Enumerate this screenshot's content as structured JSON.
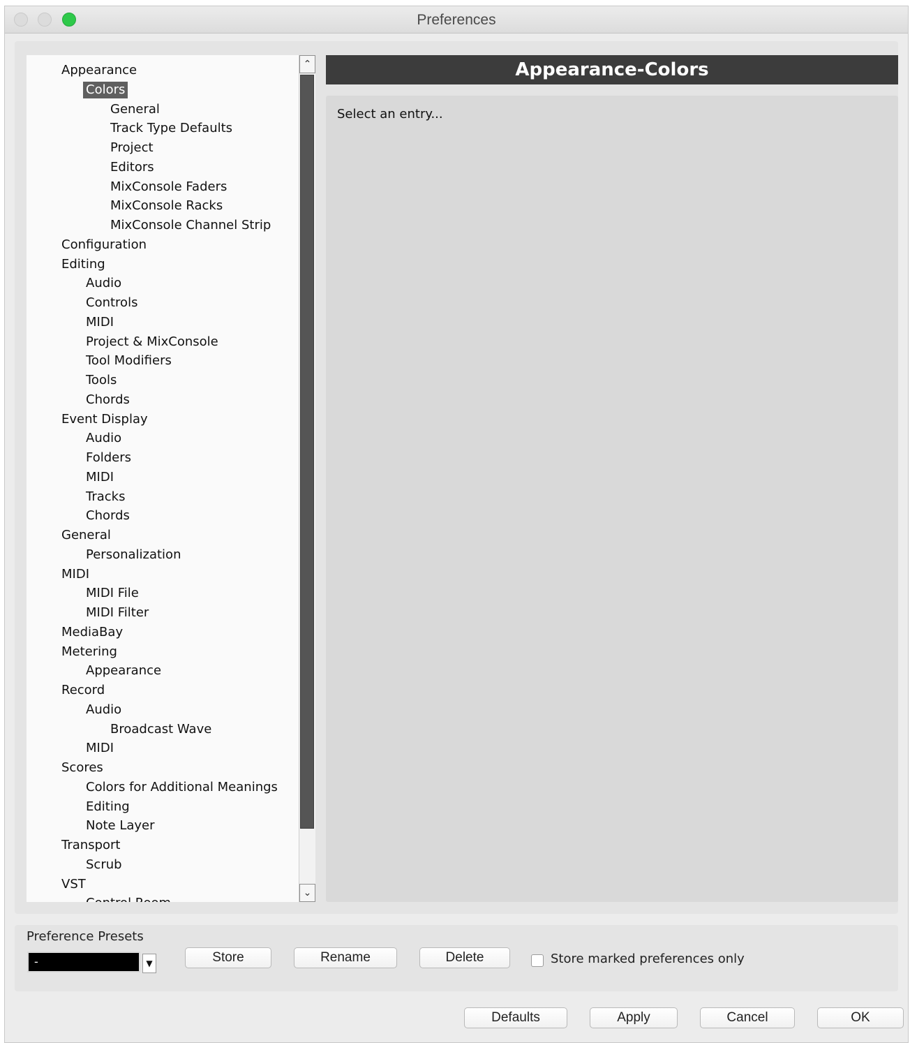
{
  "window": {
    "title": "Preferences"
  },
  "tree": [
    {
      "label": "Appearance",
      "level": 0
    },
    {
      "label": "Colors",
      "level": 1,
      "selected": true
    },
    {
      "label": "General",
      "level": 2
    },
    {
      "label": "Track Type Defaults",
      "level": 2
    },
    {
      "label": "Project",
      "level": 2
    },
    {
      "label": "Editors",
      "level": 2
    },
    {
      "label": "MixConsole Faders",
      "level": 2
    },
    {
      "label": "MixConsole Racks",
      "level": 2
    },
    {
      "label": "MixConsole Channel Strip",
      "level": 2
    },
    {
      "label": "Configuration",
      "level": 0
    },
    {
      "label": "Editing",
      "level": 0
    },
    {
      "label": "Audio",
      "level": 1
    },
    {
      "label": "Controls",
      "level": 1
    },
    {
      "label": "MIDI",
      "level": 1
    },
    {
      "label": "Project & MixConsole",
      "level": 1
    },
    {
      "label": "Tool Modifiers",
      "level": 1
    },
    {
      "label": "Tools",
      "level": 1
    },
    {
      "label": "Chords",
      "level": 1
    },
    {
      "label": "Event Display",
      "level": 0
    },
    {
      "label": "Audio",
      "level": 1
    },
    {
      "label": "Folders",
      "level": 1
    },
    {
      "label": "MIDI",
      "level": 1
    },
    {
      "label": "Tracks",
      "level": 1
    },
    {
      "label": "Chords",
      "level": 1
    },
    {
      "label": "General",
      "level": 0
    },
    {
      "label": "Personalization",
      "level": 1
    },
    {
      "label": "MIDI",
      "level": 0
    },
    {
      "label": "MIDI File",
      "level": 1
    },
    {
      "label": "MIDI Filter",
      "level": 1
    },
    {
      "label": "MediaBay",
      "level": 0
    },
    {
      "label": "Metering",
      "level": 0
    },
    {
      "label": "Appearance",
      "level": 1
    },
    {
      "label": "Record",
      "level": 0
    },
    {
      "label": "Audio",
      "level": 1
    },
    {
      "label": "Broadcast Wave",
      "level": 2
    },
    {
      "label": "MIDI",
      "level": 1
    },
    {
      "label": "Scores",
      "level": 0
    },
    {
      "label": "Colors for Additional Meanings",
      "level": 1
    },
    {
      "label": "Editing",
      "level": 1
    },
    {
      "label": "Note Layer",
      "level": 1
    },
    {
      "label": "Transport",
      "level": 0
    },
    {
      "label": "Scrub",
      "level": 1
    },
    {
      "label": "VST",
      "level": 0
    },
    {
      "label": "Control Room",
      "level": 1
    }
  ],
  "content": {
    "header": "Appearance-Colors",
    "prompt": "Select an entry..."
  },
  "presets": {
    "label": "Preference Presets",
    "selected_value": "-",
    "store_button": "Store",
    "rename_button": "Rename",
    "delete_button": "Delete",
    "checkbox_label": "Store marked preferences only",
    "checkbox_checked": false
  },
  "footer": {
    "defaults_button": "Defaults",
    "apply_button": "Apply",
    "cancel_button": "Cancel",
    "ok_button": "OK"
  },
  "colors": {
    "header_bg": "#3c3c3c",
    "selection_bg": "#5f5f5f",
    "zoom_button": "#2ec94a"
  }
}
